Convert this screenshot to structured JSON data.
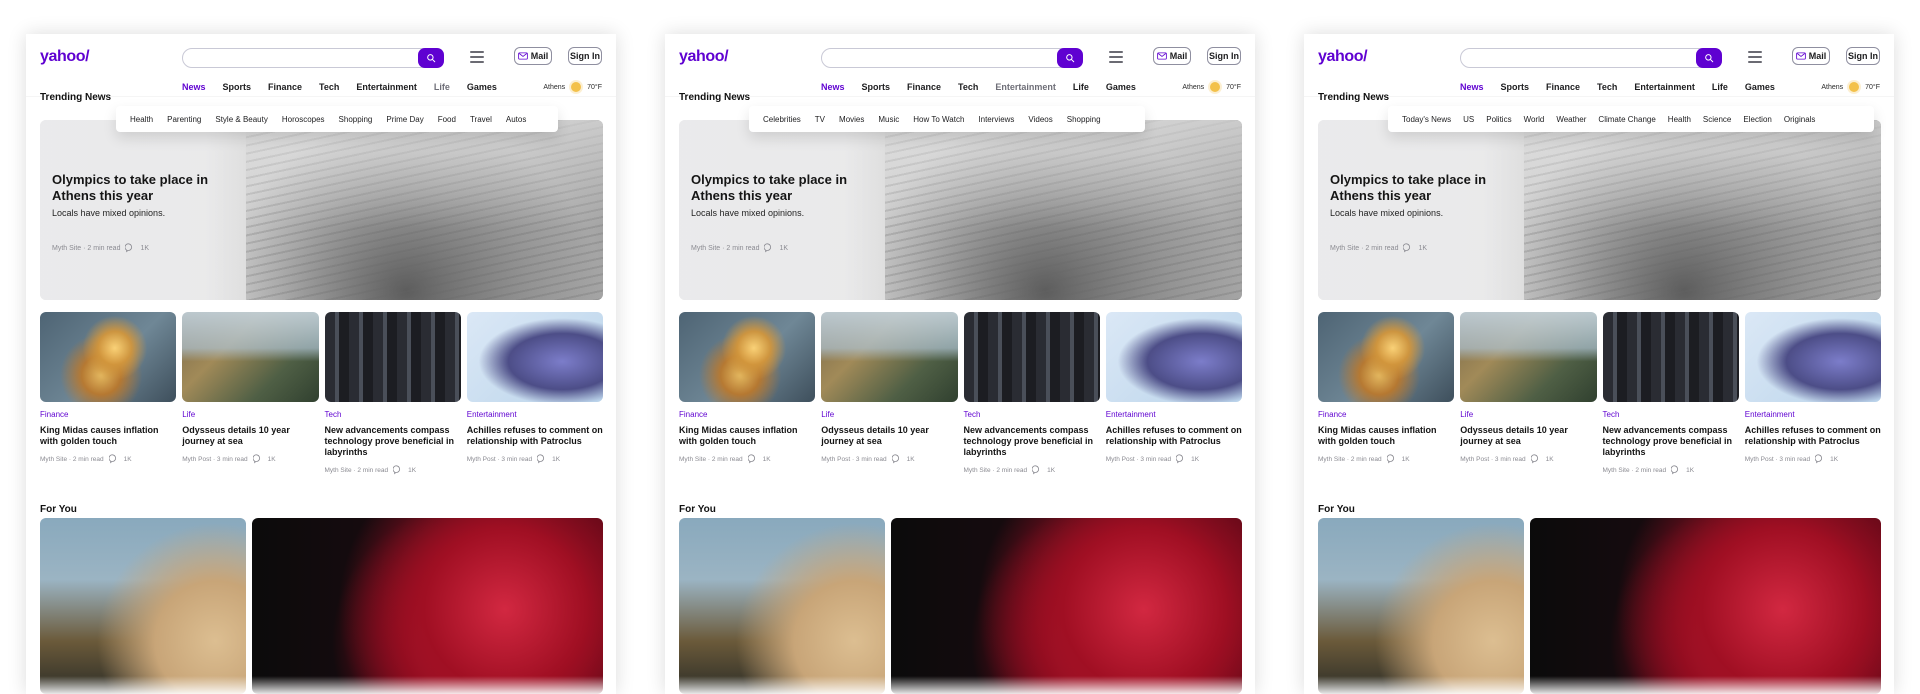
{
  "colors": {
    "brand_purple": "#5f01d1",
    "text_dark": "#1d1d1f",
    "meta_gray": "#8b8b92"
  },
  "panels": [
    {
      "logo": "yahoo/",
      "header": {
        "mail_label": "Mail",
        "signin_label": "Sign In"
      },
      "nav": {
        "items": [
          "News",
          "Sports",
          "Finance",
          "Tech",
          "Entertainment",
          "Life",
          "Games"
        ],
        "active": "News",
        "muted": "Life"
      },
      "weather": {
        "city": "Athens",
        "temp": "70°F",
        "icon": "sun-icon"
      },
      "trending_title": "Trending News",
      "mega_menu": [
        "Health",
        "Parenting",
        "Style & Beauty",
        "Horoscopes",
        "Shopping",
        "Prime Day",
        "Food",
        "Travel",
        "Autos"
      ],
      "hero": {
        "title": "Olympics to take place in Athens this year",
        "subtitle": "Locals have mixed opinions.",
        "meta": "Myth Site · 2 min read",
        "comments": "1K"
      },
      "cards": [
        {
          "kicker": "Finance",
          "title": "King Midas causes inflation with golden touch",
          "meta": "Myth Site · 2 min read",
          "comments": "1K"
        },
        {
          "kicker": "Life",
          "title": "Odysseus details 10 year journey at sea",
          "meta": "Myth Post · 3 min read",
          "comments": "1K"
        },
        {
          "kicker": "Tech",
          "title": "New advancements compass technology prove beneficial in labyrinths",
          "meta": "Myth Site · 2 min read",
          "comments": "1K"
        },
        {
          "kicker": "Entertainment",
          "title": "Achilles refuses to comment on relationship with Patroclus",
          "meta": "Myth Post · 3 min read",
          "comments": "1K"
        }
      ],
      "for_you_title": "For You"
    },
    {
      "logo": "yahoo/",
      "header": {
        "mail_label": "Mail",
        "signin_label": "Sign In"
      },
      "nav": {
        "items": [
          "News",
          "Sports",
          "Finance",
          "Tech",
          "Entertainment",
          "Life",
          "Games"
        ],
        "active": "News",
        "muted": "Entertainment"
      },
      "weather": {
        "city": "Athens",
        "temp": "70°F",
        "icon": "sun-icon"
      },
      "trending_title": "Trending News",
      "mega_menu": [
        "Celebrities",
        "TV",
        "Movies",
        "Music",
        "How To Watch",
        "Interviews",
        "Videos",
        "Shopping"
      ],
      "hero": {
        "title": "Olympics to take place in Athens this year",
        "subtitle": "Locals have mixed opinions.",
        "meta": "Myth Site · 2 min read",
        "comments": "1K"
      },
      "cards": [
        {
          "kicker": "Finance",
          "title": "King Midas causes inflation with golden touch",
          "meta": "Myth Site · 2 min read",
          "comments": "1K"
        },
        {
          "kicker": "Life",
          "title": "Odysseus details 10 year journey at sea",
          "meta": "Myth Post · 3 min read",
          "comments": "1K"
        },
        {
          "kicker": "Tech",
          "title": "New advancements compass technology prove beneficial in labyrinths",
          "meta": "Myth Site · 2 min read",
          "comments": "1K"
        },
        {
          "kicker": "Entertainment",
          "title": "Achilles refuses to comment on relationship with Patroclus",
          "meta": "Myth Post · 3 min read",
          "comments": "1K"
        }
      ],
      "for_you_title": "For You"
    },
    {
      "logo": "yahoo/",
      "header": {
        "mail_label": "Mail",
        "signin_label": "Sign In"
      },
      "nav": {
        "items": [
          "News",
          "Sports",
          "Finance",
          "Tech",
          "Entertainment",
          "Life",
          "Games"
        ],
        "active": "News",
        "muted": ""
      },
      "weather": {
        "city": "Athens",
        "temp": "70°F",
        "icon": "sun-icon"
      },
      "trending_title": "Trending News",
      "mega_menu": [
        "Today's News",
        "US",
        "Politics",
        "World",
        "Weather",
        "Climate Change",
        "Health",
        "Science",
        "Election",
        "Originals"
      ],
      "hero": {
        "title": "Olympics to take place in Athens this year",
        "subtitle": "Locals have mixed opinions.",
        "meta": "Myth Site · 2 min read",
        "comments": "1K"
      },
      "cards": [
        {
          "kicker": "Finance",
          "title": "King Midas causes inflation with golden touch",
          "meta": "Myth Site · 2 min read",
          "comments": "1K"
        },
        {
          "kicker": "Life",
          "title": "Odysseus details 10 year journey at sea",
          "meta": "Myth Post · 3 min read",
          "comments": "1K"
        },
        {
          "kicker": "Tech",
          "title": "New advancements compass technology prove beneficial in labyrinths",
          "meta": "Myth Site · 2 min read",
          "comments": "1K"
        },
        {
          "kicker": "Entertainment",
          "title": "Achilles refuses to comment on relationship with Patroclus",
          "meta": "Myth Post · 3 min read",
          "comments": "1K"
        }
      ],
      "for_you_title": "For You"
    }
  ]
}
